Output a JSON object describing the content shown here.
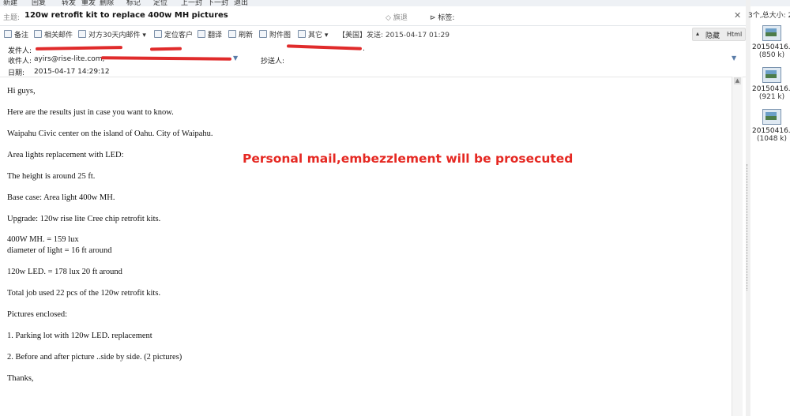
{
  "top_menu": [
    "新建",
    "回复",
    "转发",
    "重发",
    "删除",
    "标记",
    "定位",
    "上一封",
    "下一封",
    "退出"
  ],
  "subject": {
    "label": "主题:",
    "text": "120w retrofit kit to replace 400w MH pictures",
    "flag": "旗退",
    "tag_label": "标签:",
    "close": "✕"
  },
  "toolbar": {
    "items": [
      "备注",
      "相关邮件",
      "对方30天内邮件",
      "定位客户",
      "翻译",
      "刷新",
      "附件图",
      "其它"
    ],
    "meta": "【美国】发送: 2015-04-17 01:29",
    "hide_label": "隐藏",
    "html_label": "Html"
  },
  "header": {
    "from_label": "发件人:",
    "to_label": "收件人:",
    "to_value": "ayirs@rise-lite.com,",
    "cc_label": "抄送人:",
    "date_label": "日期:",
    "date_value": "2015-04-17 14:29:12"
  },
  "body": {
    "lines": [
      "Hi guys,",
      "Here are the results just in case you want to know.",
      "Waipahu Civic center on the island of Oahu. City of Waipahu.",
      "Area lights replacement with LED:",
      "The height is around 25 ft.",
      "Base case: Area light 400w MH.",
      "Upgrade: 120w rise lite Cree chip retrofit kits.",
      "400W MH. = 159 lux",
      "diameter of light = 16 ft around",
      "120w LED.  = 178 lux  20 ft around",
      "Total job used 22 pcs of the 120w retrofit kits.",
      "Pictures enclosed:",
      "1.  Parking lot with 120w LED.  replacement",
      "2.  Before and after picture ..side by side. (2 pictures)",
      "Thanks,"
    ]
  },
  "watermark": "Personal  mail,embezzlement  will be prosecuted",
  "attachments": {
    "count_text": "3个,总大小: 2.",
    "items": [
      {
        "name": "20150416...",
        "size": "(850 k)"
      },
      {
        "name": "20150416...",
        "size": "(921 k)"
      },
      {
        "name": "20150416...",
        "size": "(1048 k)"
      }
    ]
  },
  "colors": {
    "watermark": "#e52822",
    "redaction": "#e02b2b"
  }
}
